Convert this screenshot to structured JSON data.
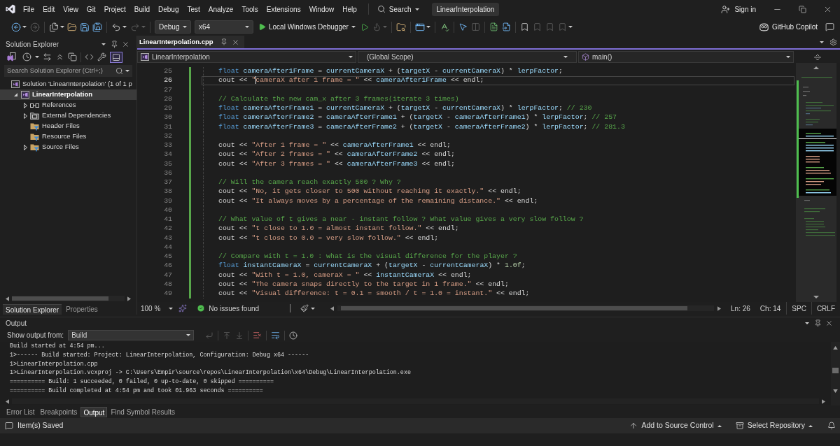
{
  "title_bar": {
    "menu": [
      "File",
      "Edit",
      "View",
      "Git",
      "Project",
      "Build",
      "Debug",
      "Test",
      "Analyze",
      "Tools",
      "Extensions",
      "Window",
      "Help"
    ],
    "search": "Search",
    "title": "LinearInterpolation",
    "sign_in": "Sign in"
  },
  "toolbar": {
    "configuration": "Debug",
    "platform": "x64",
    "debugger": "Local Windows Debugger",
    "assistant": "GitHub Copilot"
  },
  "solution_explorer": {
    "title": "Solution Explorer",
    "toolbar_toggle": {
      "on": true
    },
    "search": {
      "placeholder": "Search Solution Explorer (Ctrl+;)"
    },
    "tree": [
      {
        "kind": "solution",
        "label": "Solution 'LinearInterpolation' (1 of 1 p",
        "selected": false,
        "children": [
          {
            "kind": "project",
            "label": "LinearInterpolation",
            "selected": true,
            "expanded": true,
            "children": [
              {
                "kind": "references",
                "label": "References",
                "selected": false,
                "expanded": false
              },
              {
                "kind": "dependencies",
                "label": "External Dependencies",
                "selected": false,
                "expanded": false
              },
              {
                "kind": "filter",
                "label": "Header Files",
                "selected": false
              },
              {
                "kind": "filter",
                "label": "Resource Files",
                "selected": false
              },
              {
                "kind": "filter",
                "label": "Source Files",
                "selected": false,
                "expanded": false
              }
            ]
          }
        ]
      }
    ],
    "tabs": [
      {
        "label": "Solution Explorer",
        "selected": true
      },
      {
        "label": "Properties",
        "selected": false
      }
    ]
  },
  "editor": {
    "tabs": [
      {
        "label": "LinearInterpolation.cpp",
        "selected": true
      }
    ],
    "navigation": {
      "project": "LinearInterpolation",
      "scope": "(Global Scope)",
      "member": "main()"
    },
    "lines": [
      {
        "number": "25",
        "current": false,
        "changed": true,
        "tokens": [
          {
            "kind": "keyword",
            "text": "float "
          },
          {
            "kind": "variable",
            "text": "cameraAfter1Frame"
          },
          {
            "kind": "plain",
            "text": " = "
          },
          {
            "kind": "variable",
            "text": "currentCameraX"
          },
          {
            "kind": "plain",
            "text": " + ("
          },
          {
            "kind": "variable",
            "text": "targetX"
          },
          {
            "kind": "plain",
            "text": " - "
          },
          {
            "kind": "variable",
            "text": "currentCameraX"
          },
          {
            "kind": "plain",
            "text": ") * "
          },
          {
            "kind": "variable",
            "text": "lerpFactor"
          },
          {
            "kind": "plain",
            "text": ";"
          }
        ]
      },
      {
        "number": "26",
        "current": true,
        "changed": true,
        "tokens": [
          {
            "kind": "plain",
            "text": "cout << "
          },
          {
            "kind": "string",
            "text": "\""
          },
          {
            "kind": "caret"
          },
          {
            "kind": "string",
            "text": "cameraX after 1 frame = \""
          },
          {
            "kind": "plain",
            "text": " << "
          },
          {
            "kind": "variable",
            "text": "cameraAfter1Frame"
          },
          {
            "kind": "plain",
            "text": " << endl;"
          }
        ]
      },
      {
        "number": "27",
        "current": false,
        "changed": true
      },
      {
        "number": "28",
        "current": false,
        "changed": true,
        "tokens": [
          {
            "kind": "comment",
            "text": "// Calculate the new cam_x after 3 frames(iterate 3 times)"
          }
        ]
      },
      {
        "number": "29",
        "current": false,
        "changed": true,
        "tokens": [
          {
            "kind": "keyword",
            "text": "float "
          },
          {
            "kind": "variable",
            "text": "cameraAfterFrame1"
          },
          {
            "kind": "plain",
            "text": " = "
          },
          {
            "kind": "variable",
            "text": "currentCameraX"
          },
          {
            "kind": "plain",
            "text": " + ("
          },
          {
            "kind": "variable",
            "text": "targetX"
          },
          {
            "kind": "plain",
            "text": " - "
          },
          {
            "kind": "variable",
            "text": "currentCameraX"
          },
          {
            "kind": "plain",
            "text": ") * "
          },
          {
            "kind": "variable",
            "text": "lerpFactor"
          },
          {
            "kind": "plain",
            "text": "; "
          },
          {
            "kind": "comment",
            "text": "// 230"
          }
        ]
      },
      {
        "number": "30",
        "current": false,
        "changed": true,
        "tokens": [
          {
            "kind": "keyword",
            "text": "float "
          },
          {
            "kind": "variable",
            "text": "cameraAfterFrame2"
          },
          {
            "kind": "plain",
            "text": " = "
          },
          {
            "kind": "variable",
            "text": "cameraAfterFrame1"
          },
          {
            "kind": "plain",
            "text": " + ("
          },
          {
            "kind": "variable",
            "text": "targetX"
          },
          {
            "kind": "plain",
            "text": " - "
          },
          {
            "kind": "variable",
            "text": "cameraAfterFrame1"
          },
          {
            "kind": "plain",
            "text": ") * "
          },
          {
            "kind": "variable",
            "text": "lerpFactor"
          },
          {
            "kind": "plain",
            "text": "; "
          },
          {
            "kind": "comment",
            "text": "// 257"
          }
        ]
      },
      {
        "number": "31",
        "current": false,
        "changed": true,
        "tokens": [
          {
            "kind": "keyword",
            "text": "float "
          },
          {
            "kind": "variable",
            "text": "cameraAfterFrame3"
          },
          {
            "kind": "plain",
            "text": " = "
          },
          {
            "kind": "variable",
            "text": "cameraAfterFrame2"
          },
          {
            "kind": "plain",
            "text": " + ("
          },
          {
            "kind": "variable",
            "text": "targetX"
          },
          {
            "kind": "plain",
            "text": " - "
          },
          {
            "kind": "variable",
            "text": "cameraAfterFrame2"
          },
          {
            "kind": "plain",
            "text": ") * "
          },
          {
            "kind": "variable",
            "text": "lerpFactor"
          },
          {
            "kind": "plain",
            "text": "; "
          },
          {
            "kind": "comment",
            "text": "// 281.3"
          }
        ]
      },
      {
        "number": "32",
        "current": false,
        "changed": true
      },
      {
        "number": "33",
        "current": false,
        "changed": true,
        "tokens": [
          {
            "kind": "plain",
            "text": "cout << "
          },
          {
            "kind": "string",
            "text": "\"After 1 frame = \""
          },
          {
            "kind": "plain",
            "text": " << "
          },
          {
            "kind": "variable",
            "text": "cameraAfterFrame1"
          },
          {
            "kind": "plain",
            "text": " << endl;"
          }
        ]
      },
      {
        "number": "34",
        "current": false,
        "changed": true,
        "tokens": [
          {
            "kind": "plain",
            "text": "cout << "
          },
          {
            "kind": "string",
            "text": "\"After 2 frames = \""
          },
          {
            "kind": "plain",
            "text": " << "
          },
          {
            "kind": "variable",
            "text": "cameraAfterFrame2"
          },
          {
            "kind": "plain",
            "text": " << endl;"
          }
        ]
      },
      {
        "number": "35",
        "current": false,
        "changed": true,
        "tokens": [
          {
            "kind": "plain",
            "text": "cout << "
          },
          {
            "kind": "string",
            "text": "\"After 3 frames = \""
          },
          {
            "kind": "plain",
            "text": " << "
          },
          {
            "kind": "variable",
            "text": "cameraAfterFrame3"
          },
          {
            "kind": "plain",
            "text": " << endl;"
          }
        ]
      },
      {
        "number": "36",
        "current": false,
        "changed": true
      },
      {
        "number": "37",
        "current": false,
        "changed": true,
        "tokens": [
          {
            "kind": "comment",
            "text": "// Will the camera reach exactly 500 ? Why ?"
          }
        ]
      },
      {
        "number": "38",
        "current": false,
        "changed": true,
        "tokens": [
          {
            "kind": "plain",
            "text": "cout << "
          },
          {
            "kind": "string",
            "text": "\"No, it gets closer to 500 without reaching it exactly.\""
          },
          {
            "kind": "plain",
            "text": " << endl;"
          }
        ]
      },
      {
        "number": "39",
        "current": false,
        "changed": true,
        "tokens": [
          {
            "kind": "plain",
            "text": "cout << "
          },
          {
            "kind": "string",
            "text": "\"It always moves by a percentage of the remaining distance.\""
          },
          {
            "kind": "plain",
            "text": " << endl;"
          }
        ]
      },
      {
        "number": "40",
        "current": false,
        "changed": true
      },
      {
        "number": "41",
        "current": false,
        "changed": true,
        "tokens": [
          {
            "kind": "comment",
            "text": "// What value of t gives a near - instant follow ? What value gives a very slow follow ?"
          }
        ]
      },
      {
        "number": "42",
        "current": false,
        "changed": true,
        "tokens": [
          {
            "kind": "plain",
            "text": "cout << "
          },
          {
            "kind": "string",
            "text": "\"t close to 1.0 = almost instant follow.\""
          },
          {
            "kind": "plain",
            "text": " << endl;"
          }
        ]
      },
      {
        "number": "43",
        "current": false,
        "changed": true,
        "tokens": [
          {
            "kind": "plain",
            "text": "cout << "
          },
          {
            "kind": "string",
            "text": "\"t close to 0.0 = very slow follow.\""
          },
          {
            "kind": "plain",
            "text": " << endl;"
          }
        ]
      },
      {
        "number": "44",
        "current": false,
        "changed": true
      },
      {
        "number": "45",
        "current": false,
        "changed": true,
        "tokens": [
          {
            "kind": "comment",
            "text": "// Compare with t = 1.0 : what is the visual difference for the player ?"
          }
        ]
      },
      {
        "number": "46",
        "current": false,
        "changed": true,
        "tokens": [
          {
            "kind": "keyword",
            "text": "float "
          },
          {
            "kind": "variable",
            "text": "instantCameraX"
          },
          {
            "kind": "plain",
            "text": " = "
          },
          {
            "kind": "variable",
            "text": "currentCameraX"
          },
          {
            "kind": "plain",
            "text": " + ("
          },
          {
            "kind": "variable",
            "text": "targetX"
          },
          {
            "kind": "plain",
            "text": " - "
          },
          {
            "kind": "variable",
            "text": "currentCameraX"
          },
          {
            "kind": "plain",
            "text": ") * "
          },
          {
            "kind": "number",
            "text": "1.0f"
          },
          {
            "kind": "plain",
            "text": ";"
          }
        ]
      },
      {
        "number": "47",
        "current": false,
        "changed": true,
        "tokens": [
          {
            "kind": "plain",
            "text": "cout << "
          },
          {
            "kind": "string",
            "text": "\"With t = 1.0, cameraX = \""
          },
          {
            "kind": "plain",
            "text": " << "
          },
          {
            "kind": "variable",
            "text": "instantCameraX"
          },
          {
            "kind": "plain",
            "text": " << endl;"
          }
        ]
      },
      {
        "number": "48",
        "current": false,
        "changed": true,
        "tokens": [
          {
            "kind": "plain",
            "text": "cout << "
          },
          {
            "kind": "string",
            "text": "\"The camera snaps directly to the target in 1 frame.\""
          },
          {
            "kind": "plain",
            "text": " << endl;"
          }
        ]
      },
      {
        "number": "49",
        "current": false,
        "changed": true,
        "tokens": [
          {
            "kind": "plain",
            "text": "cout << "
          },
          {
            "kind": "string",
            "text": "\"Visual difference: t = 0.1 = smooth / t = 1.0 = instant.\""
          },
          {
            "kind": "plain",
            "text": " << endl;"
          }
        ]
      }
    ],
    "status": {
      "zoom": "100 %",
      "issues": "No issues found",
      "line": "Ln: 26",
      "column": "Ch: 14",
      "whitespace": "SPC",
      "line_ending": "CRLF"
    }
  },
  "output": {
    "title": "Output",
    "source_label": "Show output from:",
    "source": "Build",
    "lines": [
      "Build started at 4:54 pm...",
      "1>------ Build started: Project: LinearInterpolation, Configuration: Debug x64 ------",
      "1>LinearInterpolation.cpp",
      "1>LinearInterpolation.vcxproj -> C:\\Users\\Empir\\source\\repos\\LinearInterpolation\\x64\\Debug\\LinearInterpolation.exe",
      "========== Build: 1 succeeded, 0 failed, 0 up-to-date, 0 skipped ==========",
      "========== Build completed at 4:54 pm and took 01.963 seconds =========="
    ],
    "tabs": [
      {
        "label": "Error List",
        "selected": false
      },
      {
        "label": "Breakpoints",
        "selected": false
      },
      {
        "label": "Output",
        "selected": true
      },
      {
        "label": "Find Symbol Results",
        "selected": false
      }
    ]
  },
  "status_bar": {
    "message": "Item(s) Saved",
    "source_control": "Add to Source Control",
    "repository": "Select Repository"
  }
}
